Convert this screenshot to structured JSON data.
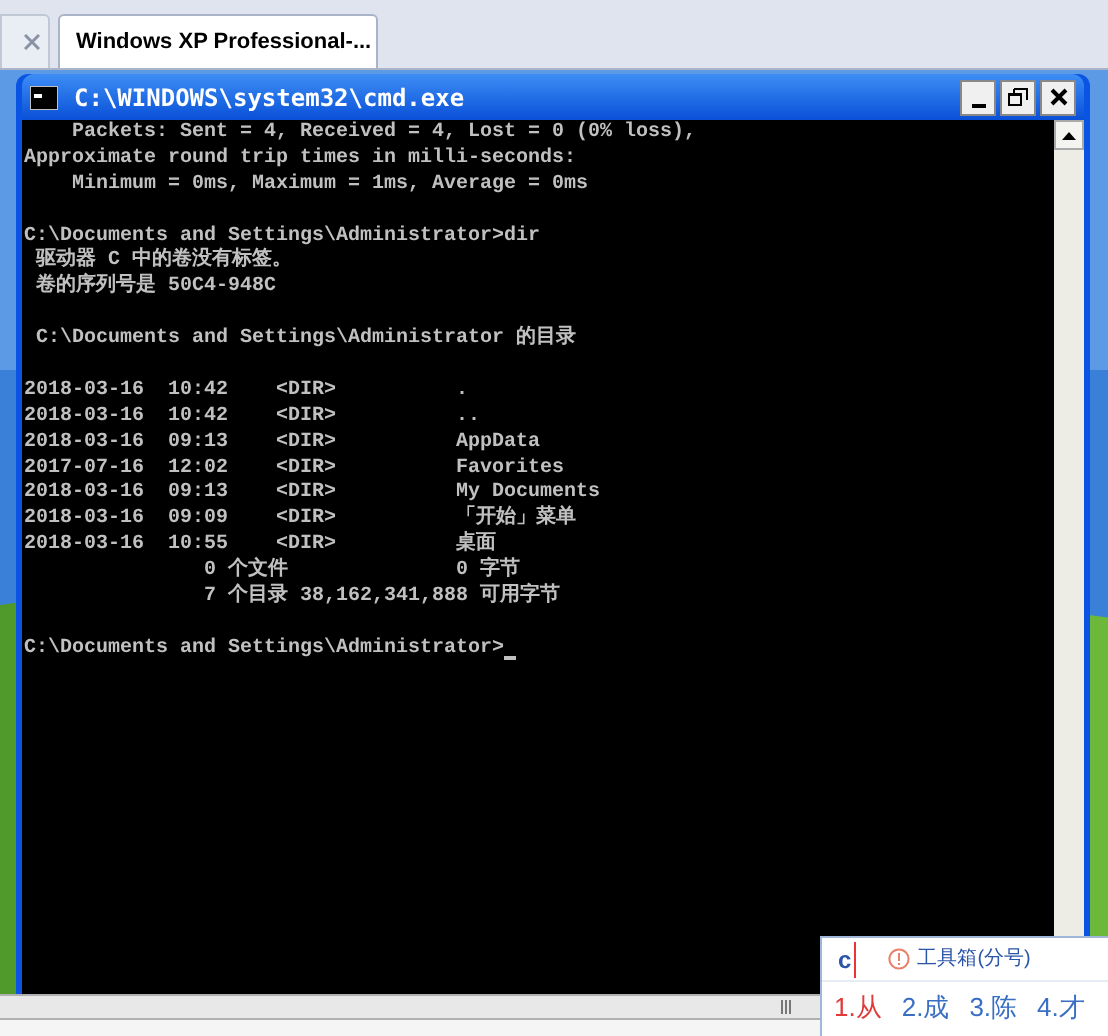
{
  "browser_tabs": [
    {
      "selected": false
    },
    {
      "label": "Windows XP Professional-...",
      "selected": true
    }
  ],
  "console_window": {
    "title": "C:\\WINDOWS\\system32\\cmd.exe",
    "blocks": [
      [
        "    Packets: Sent = 4, Received = 4, Lost = 0 (0% loss),",
        "Approximate round trip times in milli-seconds:",
        "    Minimum = 0ms, Maximum = 1ms, Average = 0ms"
      ],
      [
        "C:\\Documents and Settings\\Administrator>dir",
        " 驱动器 C 中的卷没有标签。",
        " 卷的序列号是 50C4-948C"
      ],
      [
        " C:\\Documents and Settings\\Administrator 的目录"
      ],
      [
        "2018-03-16  10:42    <DIR>          .",
        "2018-03-16  10:42    <DIR>          ..",
        "2018-03-16  09:13    <DIR>          AppData",
        "2017-07-16  12:02    <DIR>          Favorites",
        "2018-03-16  09:13    <DIR>          My Documents",
        "2018-03-16  09:09    <DIR>          「开始」菜单",
        "2018-03-16  10:55    <DIR>          桌面",
        "               0 个文件              0 字节",
        "               7 个目录 38,162,341,888 可用字节"
      ],
      [
        "C:\\Documents and Settings\\Administrator>"
      ]
    ]
  },
  "ime": {
    "input": "c",
    "toolbox": "工具箱(分号)",
    "candidates": [
      {
        "label": "1.从",
        "selected": true
      },
      {
        "label": "2.成",
        "selected": false
      },
      {
        "label": "3.陈",
        "selected": false
      },
      {
        "label": "4.才",
        "selected": false
      }
    ]
  }
}
